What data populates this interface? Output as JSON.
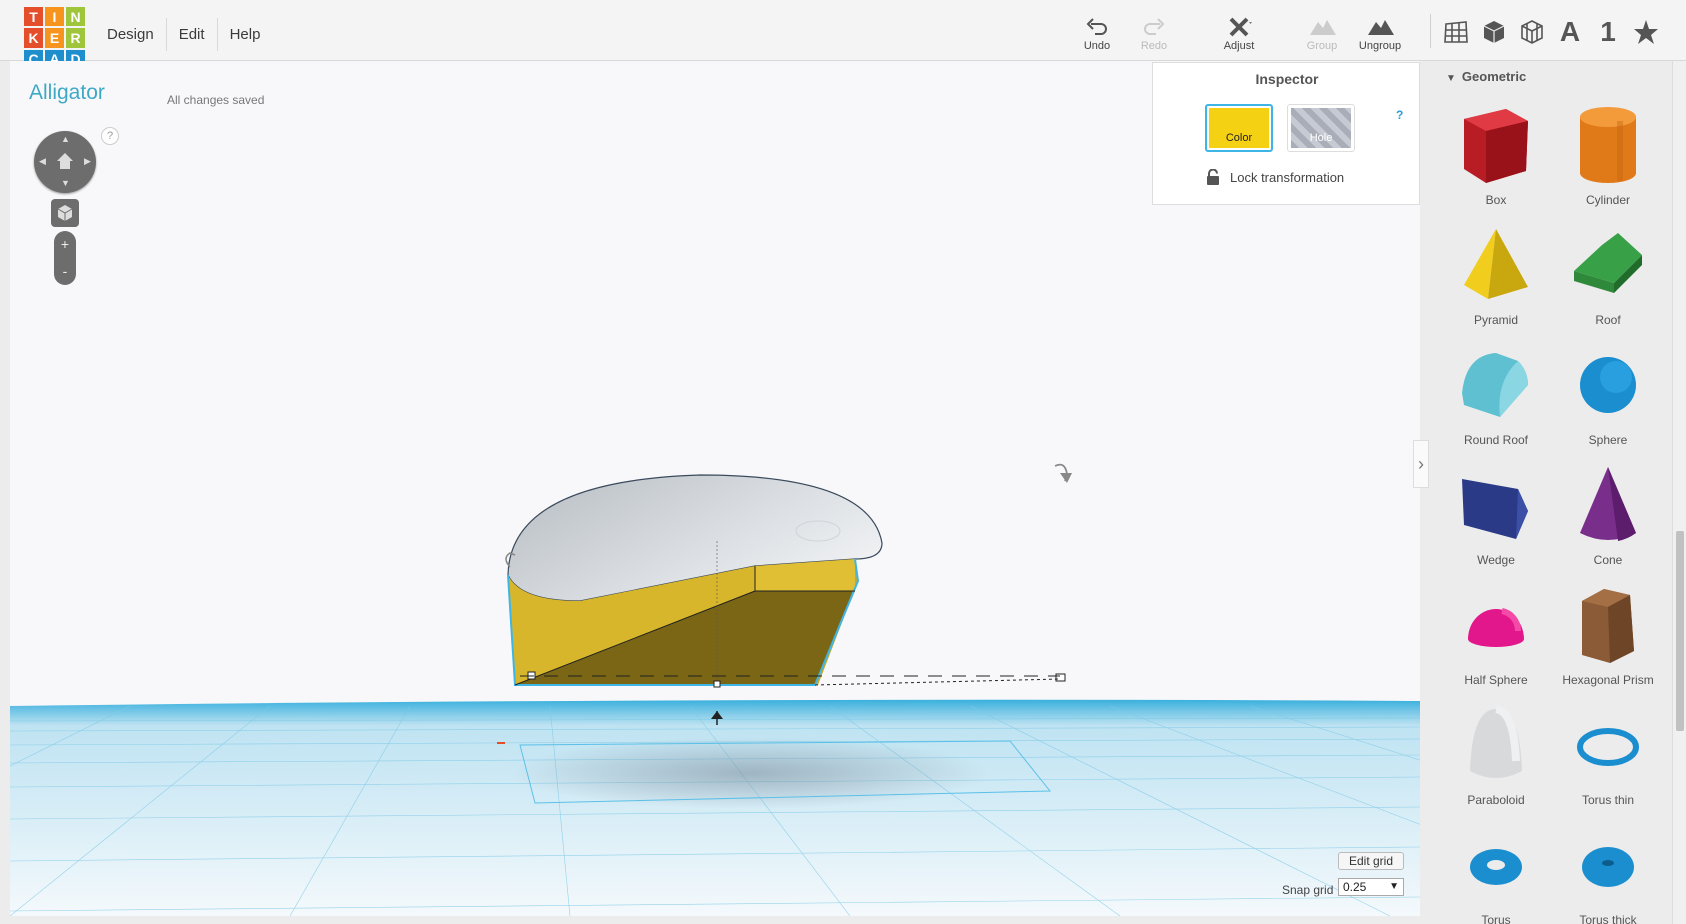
{
  "logo": {
    "letters": [
      "T",
      "I",
      "N",
      "K",
      "E",
      "R",
      "C",
      "A",
      "D"
    ],
    "colors": [
      "#e44e2b",
      "#f7941d",
      "#9fc53a",
      "#e44e2b",
      "#f7941d",
      "#9fc53a",
      "#1f8ecd",
      "#1f8ecd",
      "#1f8ecd"
    ]
  },
  "menu": [
    "Design",
    "Edit",
    "Help"
  ],
  "toolbar": {
    "undo": "Undo",
    "redo": "Redo",
    "adjust": "Adjust",
    "group": "Group",
    "ungroup": "Ungroup"
  },
  "view_icons": {
    "text_icon": "A",
    "number_icon": "1"
  },
  "design": {
    "title": "Alligator",
    "status": "All changes saved"
  },
  "nav": {
    "help": "?",
    "zoom_in": "+",
    "zoom_out": "-"
  },
  "inspector": {
    "title": "Inspector",
    "help": "?",
    "color_label": "Color",
    "hole_label": "Hole",
    "lock_label": "Lock transformation",
    "color_value": "#f5d114"
  },
  "grid": {
    "edit_label": "Edit grid",
    "snap_label": "Snap grid",
    "snap_value": "0.25"
  },
  "panel": {
    "category": "Geometric",
    "shapes": [
      {
        "label": "Box",
        "icon": "box-icon"
      },
      {
        "label": "Cylinder",
        "icon": "cylinder-icon"
      },
      {
        "label": "Pyramid",
        "icon": "pyramid-icon"
      },
      {
        "label": "Roof",
        "icon": "roof-icon"
      },
      {
        "label": "Round Roof",
        "icon": "round-roof-icon"
      },
      {
        "label": "Sphere",
        "icon": "sphere-icon"
      },
      {
        "label": "Wedge",
        "icon": "wedge-icon"
      },
      {
        "label": "Cone",
        "icon": "cone-icon"
      },
      {
        "label": "Half Sphere",
        "icon": "half-sphere-icon"
      },
      {
        "label": "Hexagonal Prism",
        "icon": "hexagonal-prism-icon"
      },
      {
        "label": "Paraboloid",
        "icon": "paraboloid-icon"
      },
      {
        "label": "Torus thin",
        "icon": "torus-thin-icon"
      },
      {
        "label": "Torus",
        "icon": "torus-icon"
      },
      {
        "label": "Torus thick",
        "icon": "torus-thick-icon"
      }
    ]
  }
}
